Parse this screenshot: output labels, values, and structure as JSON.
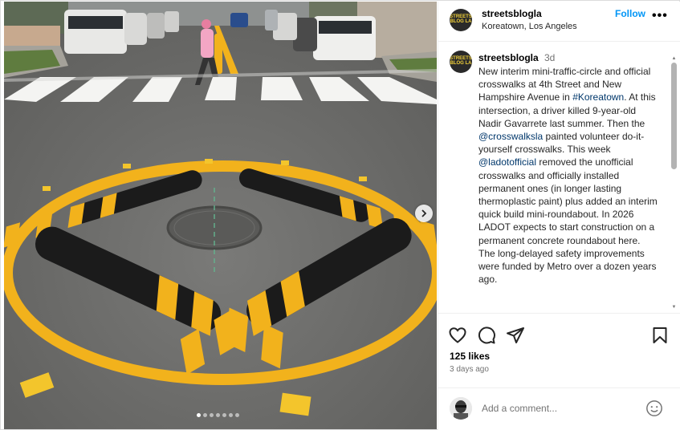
{
  "post": {
    "username": "streetsblogla",
    "location": "Koreatown, Los Angeles",
    "follow_label": "Follow",
    "more_label": "•••",
    "avatar_text": "STREETS BLOG LA",
    "caption": {
      "username": "streetsblogla",
      "time": "3d",
      "parts": [
        {
          "text": "New interim mini-traffic-circle and official crosswalks at 4th Street and New Hampshire Avenue in ",
          "link": false
        },
        {
          "text": "#Koreatown",
          "link": true
        },
        {
          "text": ". At this intersection, a driver killed 9-year-old Nadir Gavarrete last summer. Then the ",
          "link": false
        },
        {
          "text": "@crosswalksla",
          "link": true
        },
        {
          "text": " painted volunteer do-it-yourself crosswalks. This week ",
          "link": false
        },
        {
          "text": "@ladotofficial",
          "link": true
        },
        {
          "text": " removed the unofficial crosswalks and officially installed permanent ones (in longer lasting thermoplastic paint) plus added an interim quick build mini-roundabout. In 2026 LADOT expects to start construction on a permanent concrete roundabout here. The long-delayed safety improvements were funded by Metro over a dozen years ago.",
          "link": false
        }
      ]
    },
    "likes": "125 likes",
    "date": "3 days ago",
    "comment_placeholder": "Add a comment...",
    "carousel": {
      "count": 7,
      "active_index": 0
    },
    "icons": {
      "like": "heart-icon",
      "comment": "speech-bubble-icon",
      "share": "paper-plane-icon",
      "save": "bookmark-icon",
      "next": "chevron-right-icon",
      "emoji": "smiley-icon",
      "more": "ellipsis-icon"
    },
    "colors": {
      "accent": "#0095f6",
      "link": "#00376b",
      "road_paint": "#f2b21c"
    }
  }
}
